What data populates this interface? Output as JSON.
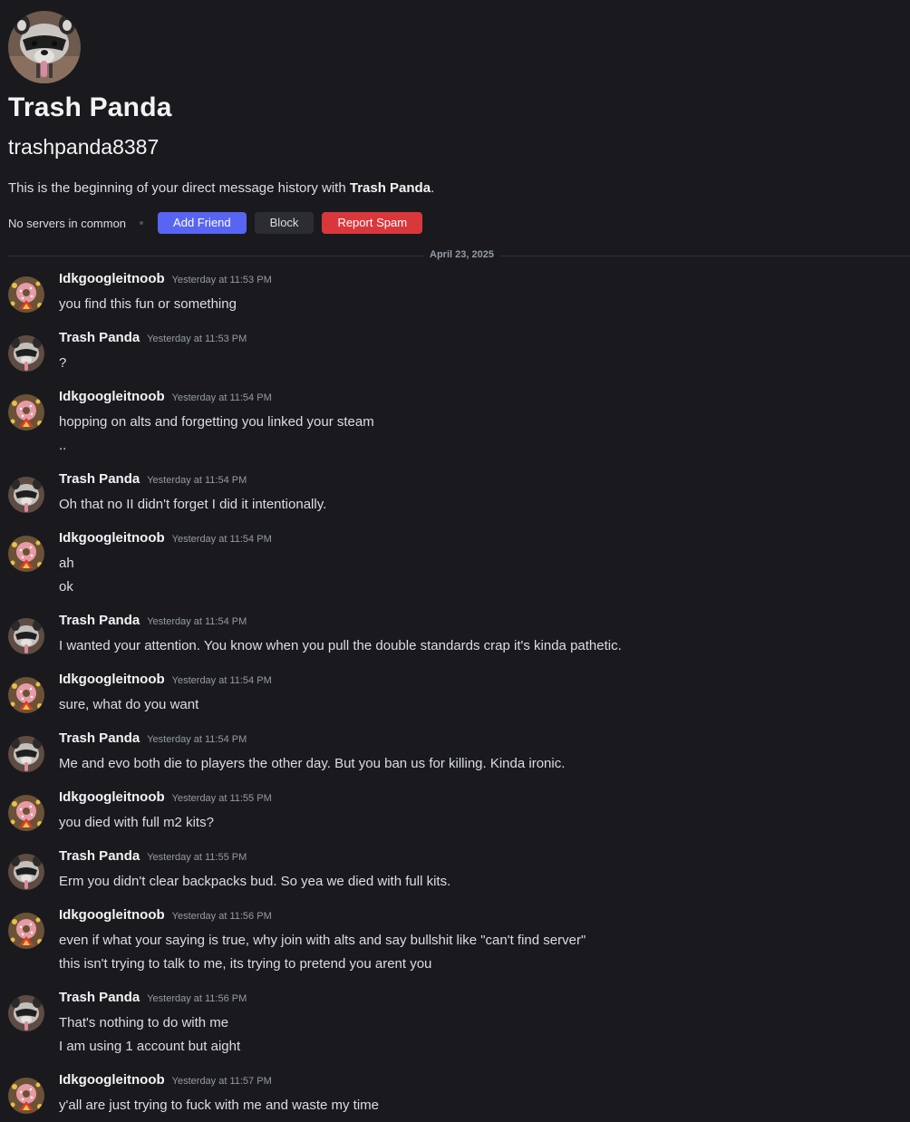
{
  "profile": {
    "display_name": "Trash Panda",
    "username": "trashpanda8387",
    "intro_prefix": "This is the beginning of your direct message history with ",
    "intro_name": "Trash Panda",
    "intro_suffix": ".",
    "mutual_servers": "No servers in common",
    "add_friend_label": "Add Friend",
    "block_label": "Block",
    "report_spam_label": "Report Spam"
  },
  "divider": {
    "date": "April 23, 2025"
  },
  "messages": [
    {
      "author": "Idkgoogleitnoob",
      "time": "Yesterday at 11:53 PM",
      "lines": [
        "you find this fun or something"
      ]
    },
    {
      "author": "Trash Panda",
      "time": "Yesterday at 11:53 PM",
      "lines": [
        "?"
      ]
    },
    {
      "author": "Idkgoogleitnoob",
      "time": "Yesterday at 11:54 PM",
      "lines": [
        "hopping on alts and forgetting you linked your steam",
        ".."
      ]
    },
    {
      "author": "Trash Panda",
      "time": "Yesterday at 11:54 PM",
      "lines": [
        "Oh that no II didn't forget I did it intentionally."
      ]
    },
    {
      "author": "Idkgoogleitnoob",
      "time": "Yesterday at 11:54 PM",
      "lines": [
        "ah",
        "ok"
      ]
    },
    {
      "author": "Trash Panda",
      "time": "Yesterday at 11:54 PM",
      "lines": [
        "I wanted your attention. You know when you pull the double standards crap it's kinda pathetic."
      ]
    },
    {
      "author": "Idkgoogleitnoob",
      "time": "Yesterday at 11:54 PM",
      "lines": [
        "sure, what do you want"
      ]
    },
    {
      "author": "Trash Panda",
      "time": "Yesterday at 11:54 PM",
      "lines": [
        "Me and evo both die to players the other day. But you ban us for killing. Kinda ironic."
      ]
    },
    {
      "author": "Idkgoogleitnoob",
      "time": "Yesterday at 11:55 PM",
      "lines": [
        "you died with full m2 kits?"
      ]
    },
    {
      "author": "Trash Panda",
      "time": "Yesterday at 11:55 PM",
      "lines": [
        "Erm you didn't clear backpacks bud. So yea we died with full kits."
      ]
    },
    {
      "author": "Idkgoogleitnoob",
      "time": "Yesterday at 11:56 PM",
      "lines": [
        "even if what your saying is true, why join with alts and say bullshit like \"can't find server\"",
        "this isn't trying to talk to me, its trying to pretend you arent you"
      ]
    },
    {
      "author": "Trash Panda",
      "time": "Yesterday at 11:56 PM",
      "lines": [
        "That's nothing to do with me",
        "I am using 1 account but aight"
      ]
    },
    {
      "author": "Idkgoogleitnoob",
      "time": "Yesterday at 11:57 PM",
      "lines": [
        "y'all are just trying to fuck with me and waste my time"
      ]
    }
  ]
}
